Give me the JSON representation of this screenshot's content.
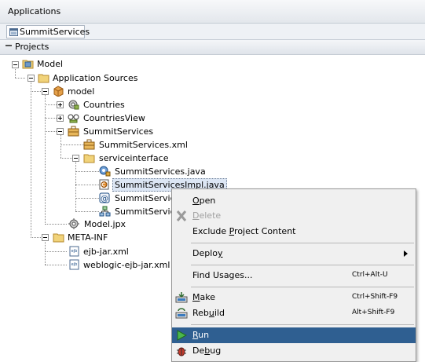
{
  "header": {
    "title": "Applications"
  },
  "app_selector": {
    "icon": "application-icon",
    "label": "SummitServices"
  },
  "projects_panel": {
    "title": "Projects",
    "collapse_icon": "collapse-minus-icon"
  },
  "tree": {
    "model": "Model",
    "application_sources": "Application Sources",
    "model_pkg": "model",
    "countries": "Countries",
    "countries_view": "CountriesView",
    "summit_services": "SummitServices",
    "summit_services_xml": "SummitServices.xml",
    "serviceinterface": "serviceinterface",
    "summit_services_java": "SummitServices.java",
    "summit_services_impl_java": "SummitServicesImpl.java",
    "summit_services_3": "SummitServices",
    "summit_services_4": "SummitServices",
    "model_jpx": "Model.jpx",
    "meta_inf": "META-INF",
    "ejb_jar_xml": "ejb-jar.xml",
    "weblogic_ejb_jar_xml": "weblogic-ejb-jar.xml"
  },
  "context_menu": {
    "open": {
      "pre": "",
      "u": "O",
      "post": "pen"
    },
    "delete": {
      "pre": "",
      "u": "D",
      "post": "elete"
    },
    "exclude": {
      "pre": "Exclude ",
      "u": "P",
      "post": "roject Content"
    },
    "deploy": {
      "pre": "Deplo",
      "u": "y",
      "post": ""
    },
    "find_usages": {
      "label": "Find Usages...",
      "shortcut": "Ctrl+Alt-U"
    },
    "make": {
      "pre": "",
      "u": "M",
      "post": "ake",
      "shortcut": "Ctrl+Shift-F9"
    },
    "rebuild": {
      "pre": "Reb",
      "u": "u",
      "post": "ild",
      "shortcut": "Alt+Shift-F9"
    },
    "run": {
      "pre": "",
      "u": "R",
      "post": "un"
    },
    "debug": {
      "pre": "De",
      "u": "b",
      "post": "ug"
    }
  },
  "colors": {
    "menu_highlight": "#2f5f91",
    "folder": "#f1d37a",
    "selection": "#dce6f4"
  }
}
